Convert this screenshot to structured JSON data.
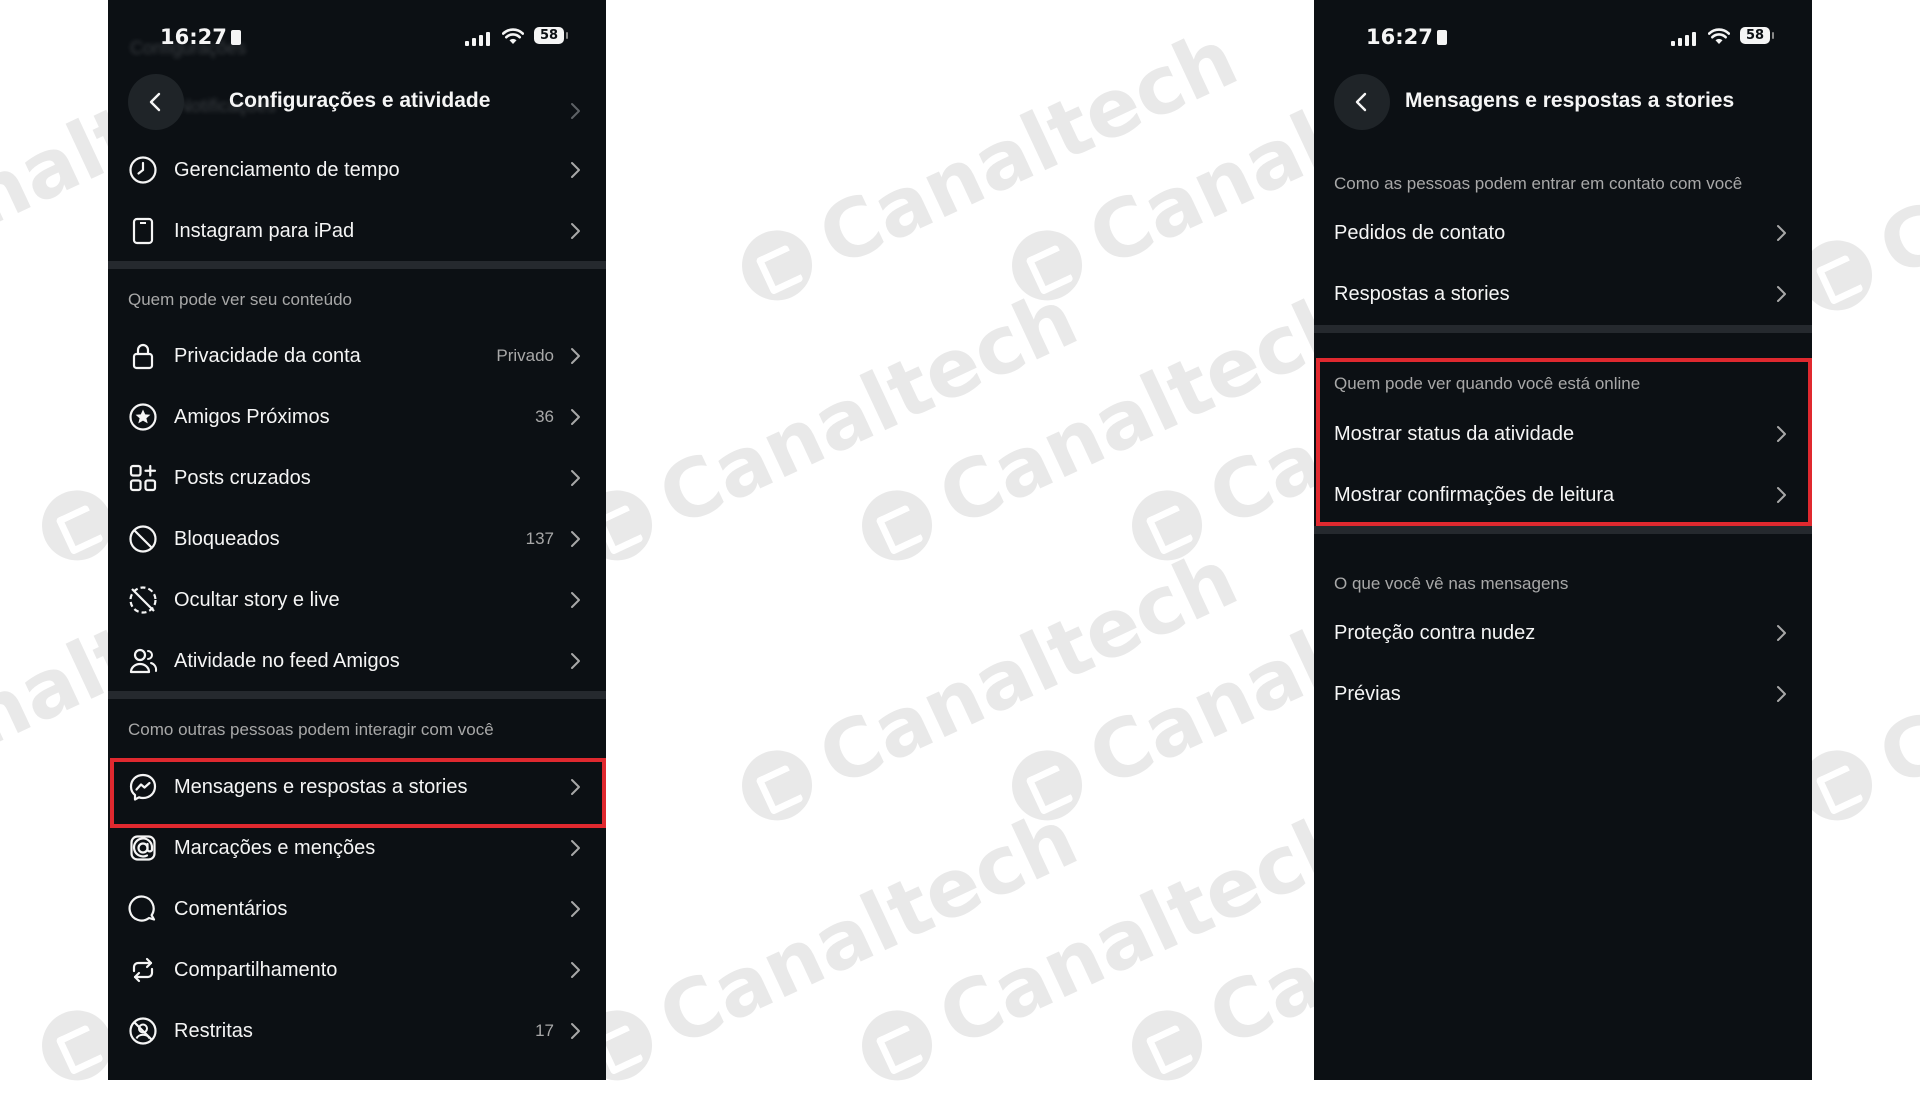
{
  "watermark": "Canaltech",
  "status": {
    "time": "16:27",
    "battery": "58"
  },
  "left": {
    "title": "Configurações e atividade",
    "ghost_items": [
      "Notificações",
      "Configurações"
    ],
    "top_items": [
      {
        "icon": "clock-icon",
        "label": "Gerenciamento de tempo",
        "value": ""
      },
      {
        "icon": "tablet-icon",
        "label": "Instagram para iPad",
        "value": ""
      }
    ],
    "section1": "Quem pode ver seu conteúdo",
    "section1_items": [
      {
        "icon": "lock-icon",
        "label": "Privacidade da conta",
        "value": "Privado"
      },
      {
        "icon": "star-circle-icon",
        "label": "Amigos Próximos",
        "value": "36"
      },
      {
        "icon": "grid-plus-icon",
        "label": "Posts cruzados",
        "value": ""
      },
      {
        "icon": "block-icon",
        "label": "Bloqueados",
        "value": "137"
      },
      {
        "icon": "hide-story-icon",
        "label": "Ocultar story e live",
        "value": ""
      },
      {
        "icon": "people-icon",
        "label": "Atividade no feed Amigos",
        "value": ""
      }
    ],
    "section2": "Como outras pessoas podem interagir com você",
    "section2_items": [
      {
        "icon": "messenger-icon",
        "label": "Mensagens e respostas a stories",
        "value": ""
      },
      {
        "icon": "at-icon",
        "label": "Marcações e menções",
        "value": ""
      },
      {
        "icon": "comment-icon",
        "label": "Comentários",
        "value": ""
      },
      {
        "icon": "share-icon",
        "label": "Compartilhamento",
        "value": ""
      },
      {
        "icon": "restrict-icon",
        "label": "Restritas",
        "value": "17"
      }
    ]
  },
  "right": {
    "title": "Mensagens e respostas a stories",
    "section1": "Como as pessoas podem entrar em contato com você",
    "section1_items": [
      {
        "label": "Pedidos de contato"
      },
      {
        "label": "Respostas a stories"
      }
    ],
    "section2": "Quem pode ver quando você está online",
    "section2_items": [
      {
        "label": "Mostrar status da atividade"
      },
      {
        "label": "Mostrar confirmações de leitura"
      }
    ],
    "section3": "O que você vê nas mensagens",
    "section3_items": [
      {
        "label": "Proteção contra nudez"
      },
      {
        "label": "Prévias"
      }
    ]
  },
  "colors": {
    "background": "#0c1014",
    "highlight": "#e0292f",
    "divider": "#25292e"
  }
}
